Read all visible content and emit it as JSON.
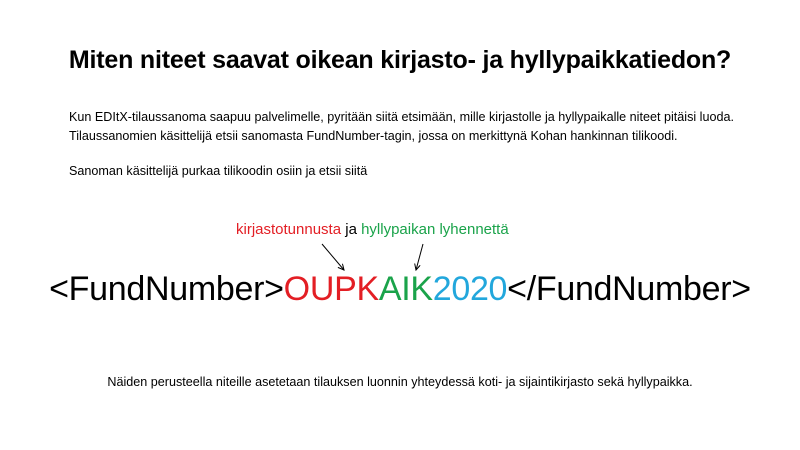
{
  "title": "Miten niteet saavat oikean kirjasto- ja hyllypaikkatiedon?",
  "intro": {
    "line1": "Kun EDItX-tilaussanoma saapuu palvelimelle, pyritään siitä etsimään, mille kirjastolle ja hyllypaikalle niteet pitäisi luoda.",
    "line2": "Tilaussanomien käsittelijä etsii sanomasta FundNumber-tagin, jossa on merkittynä Kohan hankinnan tilikoodi."
  },
  "parse_text": "Sanoman käsittelijä purkaa tilikoodin osiin ja etsii siitä",
  "annotation": {
    "library_code_label": "kirjastotunnusta",
    "conjunction": " ja ",
    "shelf_abbrev_label": "hyllypaikan lyhennettä"
  },
  "code": {
    "open_tag": "<FundNumber>",
    "library_part": "OUPK",
    "shelf_part": "AIK",
    "year_part": "2020",
    "close_tag": "</FundNumber>"
  },
  "footer": "Näiden perusteella niteille asetetaan tilauksen luonnin yhteydessä koti- ja sijaintikirjasto sekä hyllypaikka.",
  "colors": {
    "library": "#e31e24",
    "shelf": "#1aa34a",
    "year": "#22a7dc"
  }
}
